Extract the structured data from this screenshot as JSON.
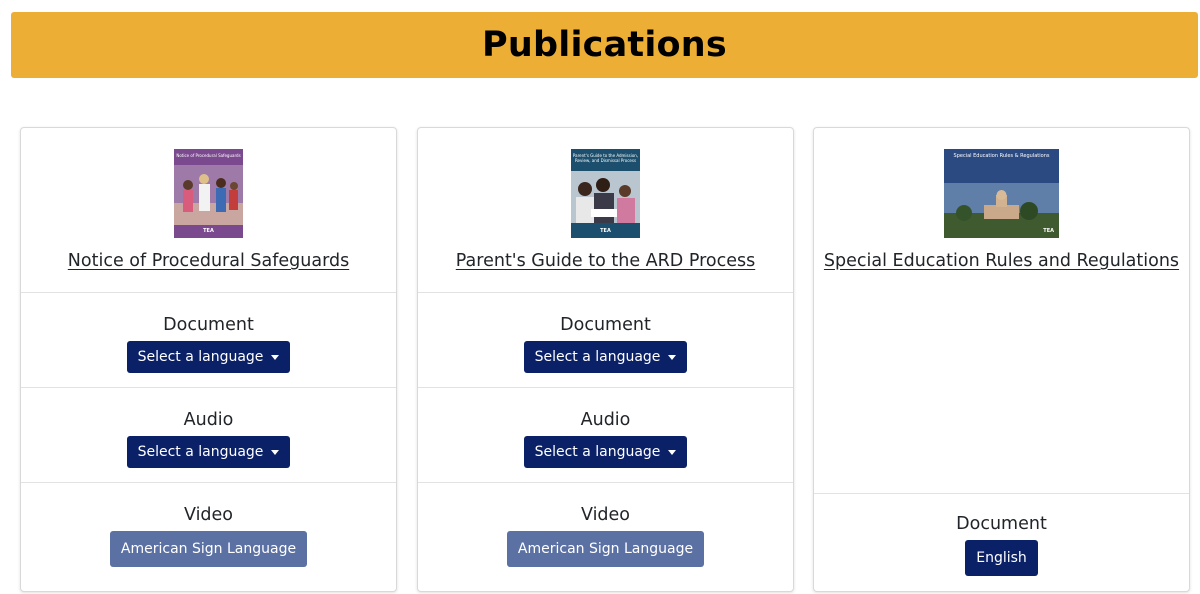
{
  "page": {
    "title": "Publications"
  },
  "cards": [
    {
      "title": "Notice of Procedural Safeguards",
      "cover_text": "Notice of Procedural Safeguards",
      "cover_tag": "TEA",
      "sections": [
        {
          "label": "Document",
          "button": "Select a language"
        },
        {
          "label": "Audio",
          "button": "Select a language"
        },
        {
          "label": "Video",
          "button": "American Sign Language"
        }
      ]
    },
    {
      "title": "Parent's Guide to the ARD Process",
      "cover_text": "Parent's Guide to the Admission, Review, and Dismissal Process",
      "cover_tag": "TEA",
      "sections": [
        {
          "label": "Document",
          "button": "Select a language"
        },
        {
          "label": "Audio",
          "button": "Select a language"
        },
        {
          "label": "Video",
          "button": "American Sign Language"
        }
      ]
    },
    {
      "title": "Special Education Rules and Regulations",
      "cover_text": "Special Education Rules & Regulations",
      "cover_tag": "TEA",
      "sections": [
        {
          "label": "Document",
          "button": "English"
        }
      ]
    }
  ],
  "colors": {
    "banner": "#edae35",
    "button_dark": "#0a2168",
    "button_light": "#5c71a3"
  },
  "icons": {
    "dropdown": "caret-down-icon"
  }
}
